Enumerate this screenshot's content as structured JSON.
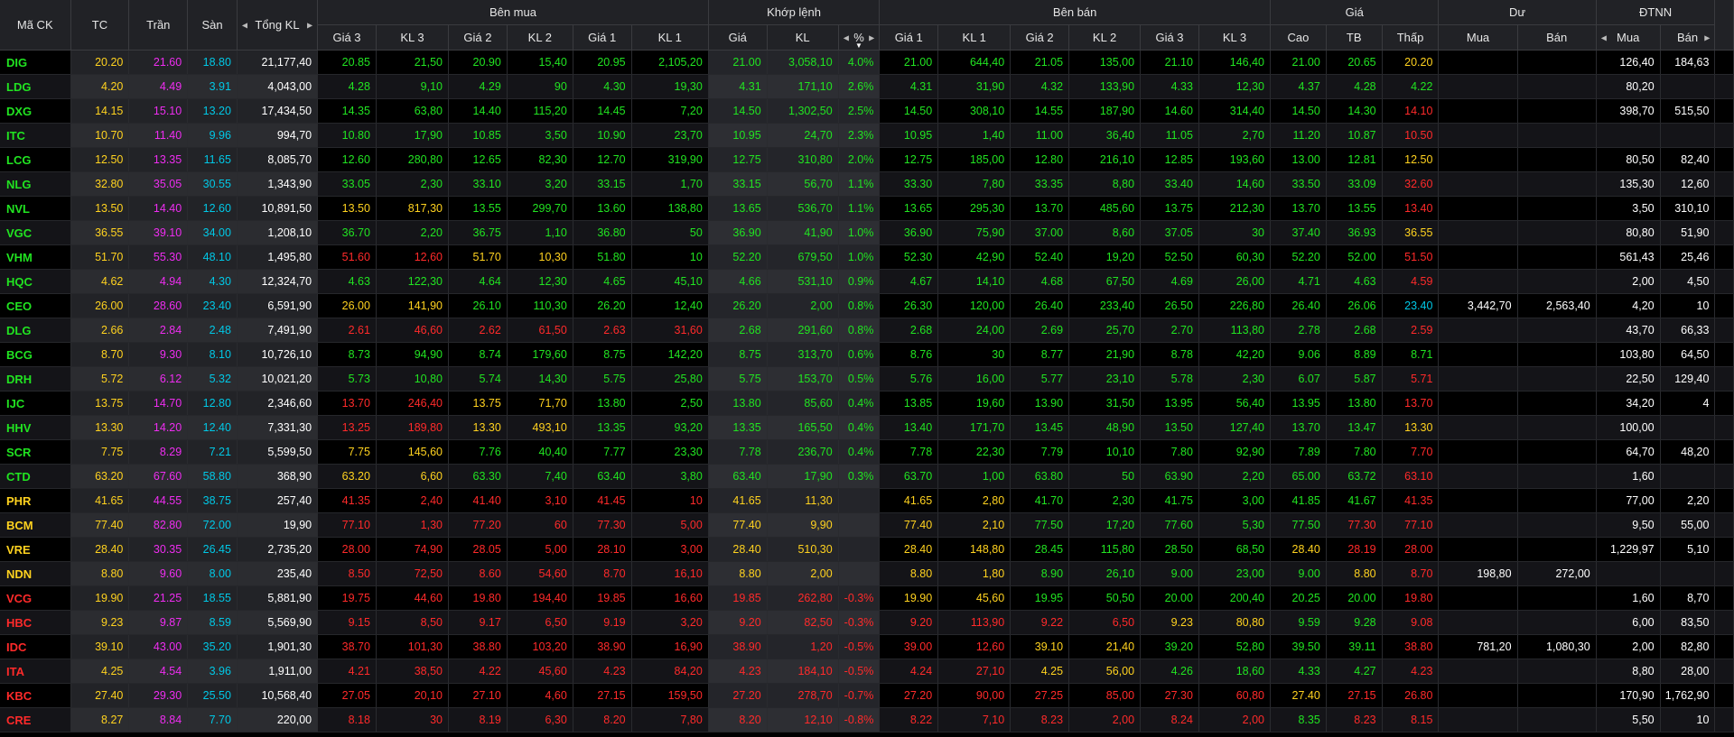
{
  "headers": {
    "symbol": "Mã CK",
    "ref": "TC",
    "ceil": "Trần",
    "floor": "Sàn",
    "total_vol": "Tổng KL",
    "buy_group": "Bên mua",
    "match_group": "Khớp lệnh",
    "sell_group": "Bên bán",
    "price_group": "Giá",
    "pending_group": "Dư",
    "foreign_group": "ĐTNN",
    "buy_cols": [
      "Giá 3",
      "KL 3",
      "Giá 2",
      "KL 2",
      "Giá 1",
      "KL 1"
    ],
    "match_cols": [
      "Giá",
      "KL",
      "%"
    ],
    "sell_cols": [
      "Giá 1",
      "KL 1",
      "Giá 2",
      "KL 2",
      "Giá 3",
      "KL 3"
    ],
    "price_cols": [
      "Cao",
      "TB",
      "Thấp"
    ],
    "pending_cols": [
      "Mua",
      "Bán"
    ],
    "foreign_cols": [
      "Mua",
      "Bán"
    ]
  },
  "colors": {
    "up": "#21e321",
    "down": "#ff2a2a",
    "ref": "#ffd21f",
    "ceiling": "#ee2df0",
    "floor": "#00c8e6",
    "header_bg": "#212226"
  },
  "sort_icon": "sort-down-icon",
  "rows": [
    [
      "DIG",
      "20.20",
      "21.60",
      "18.80",
      "21,177,40",
      "20.85",
      "21,50",
      "20.90",
      "15,40",
      "20.95",
      "2,105,20",
      "21.00",
      "3,058,10",
      "4.0%",
      "21.00",
      "644,40",
      "21.05",
      "135,00",
      "21.10",
      "146,40",
      "21.00",
      "20.65",
      "20.20",
      "",
      "",
      "126,40",
      "184,63"
    ],
    [
      "LDG",
      "4.20",
      "4.49",
      "3.91",
      "4,043,00",
      "4.28",
      "9,10",
      "4.29",
      "90",
      "4.30",
      "19,30",
      "4.31",
      "171,10",
      "2.6%",
      "4.31",
      "31,90",
      "4.32",
      "133,90",
      "4.33",
      "12,30",
      "4.37",
      "4.28",
      "4.22",
      "",
      "",
      "80,20",
      ""
    ],
    [
      "DXG",
      "14.15",
      "15.10",
      "13.20",
      "17,434,50",
      "14.35",
      "63,80",
      "14.40",
      "115,20",
      "14.45",
      "7,20",
      "14.50",
      "1,302,50",
      "2.5%",
      "14.50",
      "308,10",
      "14.55",
      "187,90",
      "14.60",
      "314,40",
      "14.50",
      "14.30",
      "14.10",
      "",
      "",
      "398,70",
      "515,50"
    ],
    [
      "ITC",
      "10.70",
      "11.40",
      "9.96",
      "994,70",
      "10.80",
      "17,90",
      "10.85",
      "3,50",
      "10.90",
      "23,70",
      "10.95",
      "24,70",
      "2.3%",
      "10.95",
      "1,40",
      "11.00",
      "36,40",
      "11.05",
      "2,70",
      "11.20",
      "10.87",
      "10.50",
      "",
      "",
      "",
      ""
    ],
    [
      "LCG",
      "12.50",
      "13.35",
      "11.65",
      "8,085,70",
      "12.60",
      "280,80",
      "12.65",
      "82,30",
      "12.70",
      "319,90",
      "12.75",
      "310,80",
      "2.0%",
      "12.75",
      "185,00",
      "12.80",
      "216,10",
      "12.85",
      "193,60",
      "13.00",
      "12.81",
      "12.50",
      "",
      "",
      "80,50",
      "82,40"
    ],
    [
      "NLG",
      "32.80",
      "35.05",
      "30.55",
      "1,343,90",
      "33.05",
      "2,30",
      "33.10",
      "3,20",
      "33.15",
      "1,70",
      "33.15",
      "56,70",
      "1.1%",
      "33.30",
      "7,80",
      "33.35",
      "8,80",
      "33.40",
      "14,60",
      "33.50",
      "33.09",
      "32.60",
      "",
      "",
      "135,30",
      "12,60"
    ],
    [
      "NVL",
      "13.50",
      "14.40",
      "12.60",
      "10,891,50",
      "13.50",
      "817,30",
      "13.55",
      "299,70",
      "13.60",
      "138,80",
      "13.65",
      "536,70",
      "1.1%",
      "13.65",
      "295,30",
      "13.70",
      "485,60",
      "13.75",
      "212,30",
      "13.70",
      "13.55",
      "13.40",
      "",
      "",
      "3,50",
      "310,10"
    ],
    [
      "VGC",
      "36.55",
      "39.10",
      "34.00",
      "1,208,10",
      "36.70",
      "2,20",
      "36.75",
      "1,10",
      "36.80",
      "50",
      "36.90",
      "41,90",
      "1.0%",
      "36.90",
      "75,90",
      "37.00",
      "8,60",
      "37.05",
      "30",
      "37.40",
      "36.93",
      "36.55",
      "",
      "",
      "80,80",
      "51,90"
    ],
    [
      "VHM",
      "51.70",
      "55.30",
      "48.10",
      "1,495,80",
      "51.60",
      "12,60",
      "51.70",
      "10,30",
      "51.80",
      "10",
      "52.20",
      "679,50",
      "1.0%",
      "52.30",
      "42,90",
      "52.40",
      "19,20",
      "52.50",
      "60,30",
      "52.20",
      "52.00",
      "51.50",
      "",
      "",
      "561,43",
      "25,46"
    ],
    [
      "HQC",
      "4.62",
      "4.94",
      "4.30",
      "12,324,70",
      "4.63",
      "122,30",
      "4.64",
      "12,30",
      "4.65",
      "45,10",
      "4.66",
      "531,10",
      "0.9%",
      "4.67",
      "14,10",
      "4.68",
      "67,50",
      "4.69",
      "26,00",
      "4.71",
      "4.63",
      "4.59",
      "",
      "",
      "2,00",
      "4,50"
    ],
    [
      "CEO",
      "26.00",
      "28.60",
      "23.40",
      "6,591,90",
      "26.00",
      "141,90",
      "26.10",
      "110,30",
      "26.20",
      "12,40",
      "26.20",
      "2,00",
      "0.8%",
      "26.30",
      "120,00",
      "26.40",
      "233,40",
      "26.50",
      "226,80",
      "26.40",
      "26.06",
      "23.40",
      "3,442,70",
      "2,563,40",
      "4,20",
      "10"
    ],
    [
      "DLG",
      "2.66",
      "2.84",
      "2.48",
      "7,491,90",
      "2.61",
      "46,60",
      "2.62",
      "61,50",
      "2.63",
      "31,60",
      "2.68",
      "291,60",
      "0.8%",
      "2.68",
      "24,00",
      "2.69",
      "25,70",
      "2.70",
      "113,80",
      "2.78",
      "2.68",
      "2.59",
      "",
      "",
      "43,70",
      "66,33"
    ],
    [
      "BCG",
      "8.70",
      "9.30",
      "8.10",
      "10,726,10",
      "8.73",
      "94,90",
      "8.74",
      "179,60",
      "8.75",
      "142,20",
      "8.75",
      "313,70",
      "0.6%",
      "8.76",
      "30",
      "8.77",
      "21,90",
      "8.78",
      "42,20",
      "9.06",
      "8.89",
      "8.71",
      "",
      "",
      "103,80",
      "64,50"
    ],
    [
      "DRH",
      "5.72",
      "6.12",
      "5.32",
      "10,021,20",
      "5.73",
      "10,80",
      "5.74",
      "14,30",
      "5.75",
      "25,80",
      "5.75",
      "153,70",
      "0.5%",
      "5.76",
      "16,00",
      "5.77",
      "23,10",
      "5.78",
      "2,30",
      "6.07",
      "5.87",
      "5.71",
      "",
      "",
      "22,50",
      "129,40"
    ],
    [
      "IJC",
      "13.75",
      "14.70",
      "12.80",
      "2,346,60",
      "13.70",
      "246,40",
      "13.75",
      "71,70",
      "13.80",
      "2,50",
      "13.80",
      "85,60",
      "0.4%",
      "13.85",
      "19,60",
      "13.90",
      "31,50",
      "13.95",
      "56,40",
      "13.95",
      "13.80",
      "13.70",
      "",
      "",
      "34,20",
      "4"
    ],
    [
      "HHV",
      "13.30",
      "14.20",
      "12.40",
      "7,331,30",
      "13.25",
      "189,80",
      "13.30",
      "493,10",
      "13.35",
      "93,20",
      "13.35",
      "165,50",
      "0.4%",
      "13.40",
      "171,70",
      "13.45",
      "48,90",
      "13.50",
      "127,40",
      "13.70",
      "13.47",
      "13.30",
      "",
      "",
      "100,00",
      ""
    ],
    [
      "SCR",
      "7.75",
      "8.29",
      "7.21",
      "5,599,50",
      "7.75",
      "145,60",
      "7.76",
      "40,40",
      "7.77",
      "23,30",
      "7.78",
      "236,70",
      "0.4%",
      "7.78",
      "22,30",
      "7.79",
      "10,10",
      "7.80",
      "92,90",
      "7.89",
      "7.80",
      "7.70",
      "",
      "",
      "64,70",
      "48,20"
    ],
    [
      "CTD",
      "63.20",
      "67.60",
      "58.80",
      "368,90",
      "63.20",
      "6,60",
      "63.30",
      "7,40",
      "63.40",
      "3,80",
      "63.40",
      "17,90",
      "0.3%",
      "63.70",
      "1,00",
      "63.80",
      "50",
      "63.90",
      "2,20",
      "65.00",
      "63.72",
      "63.10",
      "",
      "",
      "1,60",
      ""
    ],
    [
      "PHR",
      "41.65",
      "44.55",
      "38.75",
      "257,40",
      "41.35",
      "2,40",
      "41.40",
      "3,10",
      "41.45",
      "10",
      "41.65",
      "11,30",
      "",
      "41.65",
      "2,80",
      "41.70",
      "2,30",
      "41.75",
      "3,00",
      "41.85",
      "41.67",
      "41.35",
      "",
      "",
      "77,00",
      "2,20"
    ],
    [
      "BCM",
      "77.40",
      "82.80",
      "72.00",
      "19,90",
      "77.10",
      "1,30",
      "77.20",
      "60",
      "77.30",
      "5,00",
      "77.40",
      "9,90",
      "",
      "77.40",
      "2,10",
      "77.50",
      "17,20",
      "77.60",
      "5,30",
      "77.50",
      "77.30",
      "77.10",
      "",
      "",
      "9,50",
      "55,00"
    ],
    [
      "VRE",
      "28.40",
      "30.35",
      "26.45",
      "2,735,20",
      "28.00",
      "74,90",
      "28.05",
      "5,00",
      "28.10",
      "3,00",
      "28.40",
      "510,30",
      "",
      "28.40",
      "148,80",
      "28.45",
      "115,80",
      "28.50",
      "68,50",
      "28.40",
      "28.19",
      "28.00",
      "",
      "",
      "1,229,97",
      "5,10"
    ],
    [
      "NDN",
      "8.80",
      "9.60",
      "8.00",
      "235,40",
      "8.50",
      "72,50",
      "8.60",
      "54,60",
      "8.70",
      "16,10",
      "8.80",
      "2,00",
      "",
      "8.80",
      "1,80",
      "8.90",
      "26,10",
      "9.00",
      "23,00",
      "9.00",
      "8.80",
      "8.70",
      "198,80",
      "272,00",
      "",
      ""
    ],
    [
      "VCG",
      "19.90",
      "21.25",
      "18.55",
      "5,881,90",
      "19.75",
      "44,60",
      "19.80",
      "194,40",
      "19.85",
      "16,60",
      "19.85",
      "262,80",
      "-0.3%",
      "19.90",
      "45,60",
      "19.95",
      "50,50",
      "20.00",
      "200,40",
      "20.25",
      "20.00",
      "19.80",
      "",
      "",
      "1,60",
      "8,70"
    ],
    [
      "HBC",
      "9.23",
      "9.87",
      "8.59",
      "5,569,90",
      "9.15",
      "8,50",
      "9.17",
      "6,50",
      "9.19",
      "3,20",
      "9.20",
      "82,50",
      "-0.3%",
      "9.20",
      "113,90",
      "9.22",
      "6,50",
      "9.23",
      "80,80",
      "9.59",
      "9.28",
      "9.08",
      "",
      "",
      "6,00",
      "83,50"
    ],
    [
      "IDC",
      "39.10",
      "43.00",
      "35.20",
      "1,901,30",
      "38.70",
      "101,30",
      "38.80",
      "103,20",
      "38.90",
      "16,90",
      "38.90",
      "1,20",
      "-0.5%",
      "39.00",
      "12,60",
      "39.10",
      "21,40",
      "39.20",
      "52,80",
      "39.50",
      "39.11",
      "38.80",
      "781,20",
      "1,080,30",
      "2,00",
      "82,80"
    ],
    [
      "ITA",
      "4.25",
      "4.54",
      "3.96",
      "1,911,00",
      "4.21",
      "38,50",
      "4.22",
      "45,60",
      "4.23",
      "84,20",
      "4.23",
      "184,10",
      "-0.5%",
      "4.24",
      "27,10",
      "4.25",
      "56,00",
      "4.26",
      "18,60",
      "4.33",
      "4.27",
      "4.23",
      "",
      "",
      "8,80",
      "28,00"
    ],
    [
      "KBC",
      "27.40",
      "29.30",
      "25.50",
      "10,568,40",
      "27.05",
      "20,10",
      "27.10",
      "4,60",
      "27.15",
      "159,50",
      "27.20",
      "278,70",
      "-0.7%",
      "27.20",
      "90,00",
      "27.25",
      "85,00",
      "27.30",
      "60,80",
      "27.40",
      "27.15",
      "26.80",
      "",
      "",
      "170,90",
      "1,762,90"
    ],
    [
      "CRE",
      "8.27",
      "8.84",
      "7.70",
      "220,00",
      "8.18",
      "30",
      "8.19",
      "6,30",
      "8.20",
      "7,80",
      "8.20",
      "12,10",
      "-0.8%",
      "8.22",
      "7,10",
      "8.23",
      "2,00",
      "8.24",
      "2,00",
      "8.35",
      "8.23",
      "8.15",
      "",
      "",
      "5,50",
      "10"
    ]
  ]
}
